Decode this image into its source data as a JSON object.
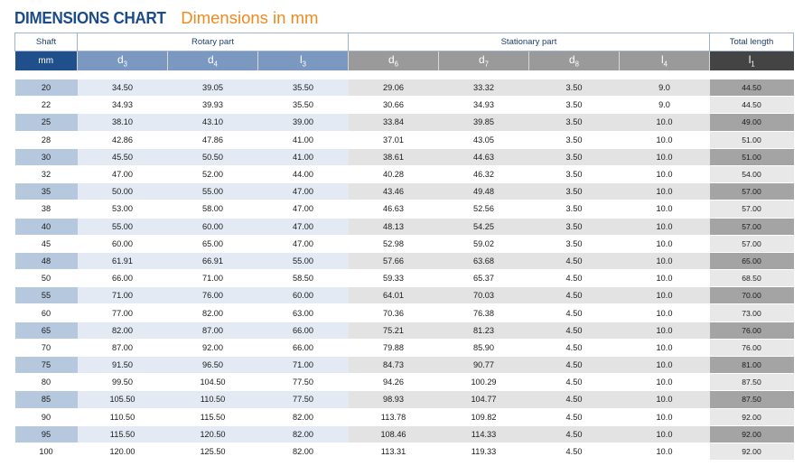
{
  "header": {
    "title": "DIMENSIONS CHART",
    "subtitle": "Dimensions in mm"
  },
  "groups": {
    "shaft": "Shaft",
    "rotary": "Rotary part",
    "stationary": "Stationary part",
    "total": "Total length"
  },
  "symbols": [
    {
      "base": "mm",
      "sub": ""
    },
    {
      "base": "d",
      "sub": "3"
    },
    {
      "base": "d",
      "sub": "4"
    },
    {
      "base": "l",
      "sub": "3"
    },
    {
      "base": "d",
      "sub": "6"
    },
    {
      "base": "d",
      "sub": "7"
    },
    {
      "base": "d",
      "sub": "8"
    },
    {
      "base": "l",
      "sub": "4"
    },
    {
      "base": "l",
      "sub": "1"
    }
  ],
  "rows": [
    [
      "20",
      "34.50",
      "39.05",
      "35.50",
      "29.06",
      "33.32",
      "3.50",
      "9.0",
      "44.50"
    ],
    [
      "22",
      "34.93",
      "39.93",
      "35.50",
      "30.66",
      "34.93",
      "3.50",
      "9.0",
      "44.50"
    ],
    [
      "25",
      "38.10",
      "43.10",
      "39.00",
      "33.84",
      "39.85",
      "3.50",
      "10.0",
      "49.00"
    ],
    [
      "28",
      "42.86",
      "47.86",
      "41.00",
      "37.01",
      "43.05",
      "3.50",
      "10.0",
      "51.00"
    ],
    [
      "30",
      "45.50",
      "50.50",
      "41.00",
      "38.61",
      "44.63",
      "3.50",
      "10.0",
      "51.00"
    ],
    [
      "32",
      "47.00",
      "52.00",
      "44.00",
      "40.28",
      "46.32",
      "3.50",
      "10.0",
      "54.00"
    ],
    [
      "35",
      "50.00",
      "55.00",
      "47.00",
      "43.46",
      "49.48",
      "3.50",
      "10.0",
      "57.00"
    ],
    [
      "38",
      "53.00",
      "58.00",
      "47.00",
      "46.63",
      "52.56",
      "3.50",
      "10.0",
      "57.00"
    ],
    [
      "40",
      "55.00",
      "60.00",
      "47.00",
      "48.13",
      "54.25",
      "3.50",
      "10.0",
      "57.00"
    ],
    [
      "45",
      "60.00",
      "65.00",
      "47.00",
      "52.98",
      "59.02",
      "3.50",
      "10.0",
      "57.00"
    ],
    [
      "48",
      "61.91",
      "66.91",
      "55.00",
      "57.66",
      "63.68",
      "4.50",
      "10.0",
      "65.00"
    ],
    [
      "50",
      "66.00",
      "71.00",
      "58.50",
      "59.33",
      "65.37",
      "4.50",
      "10.0",
      "68.50"
    ],
    [
      "55",
      "71.00",
      "76.00",
      "60.00",
      "64.01",
      "70.03",
      "4.50",
      "10.0",
      "70.00"
    ],
    [
      "60",
      "77.00",
      "82.00",
      "63.00",
      "70.36",
      "76.38",
      "4.50",
      "10.0",
      "73.00"
    ],
    [
      "65",
      "82.00",
      "87.00",
      "66.00",
      "75.21",
      "81.23",
      "4.50",
      "10.0",
      "76.00"
    ],
    [
      "70",
      "87.00",
      "92.00",
      "66.00",
      "79.88",
      "85.90",
      "4.50",
      "10.0",
      "76.00"
    ],
    [
      "75",
      "91.50",
      "96.50",
      "71.00",
      "84.73",
      "90.77",
      "4.50",
      "10.0",
      "81.00"
    ],
    [
      "80",
      "99.50",
      "104.50",
      "77.50",
      "94.26",
      "100.29",
      "4.50",
      "10.0",
      "87.50"
    ],
    [
      "85",
      "105.50",
      "110.50",
      "77.50",
      "98.93",
      "104.77",
      "4.50",
      "10.0",
      "87.50"
    ],
    [
      "90",
      "110.50",
      "115.50",
      "82.00",
      "113.78",
      "109.82",
      "4.50",
      "10.0",
      "92.00"
    ],
    [
      "95",
      "115.50",
      "120.50",
      "82.00",
      "108.46",
      "114.33",
      "4.50",
      "10.0",
      "92.00"
    ],
    [
      "100",
      "120.00",
      "125.50",
      "82.00",
      "113.31",
      "119.33",
      "4.50",
      "10.0",
      "92.00"
    ]
  ]
}
